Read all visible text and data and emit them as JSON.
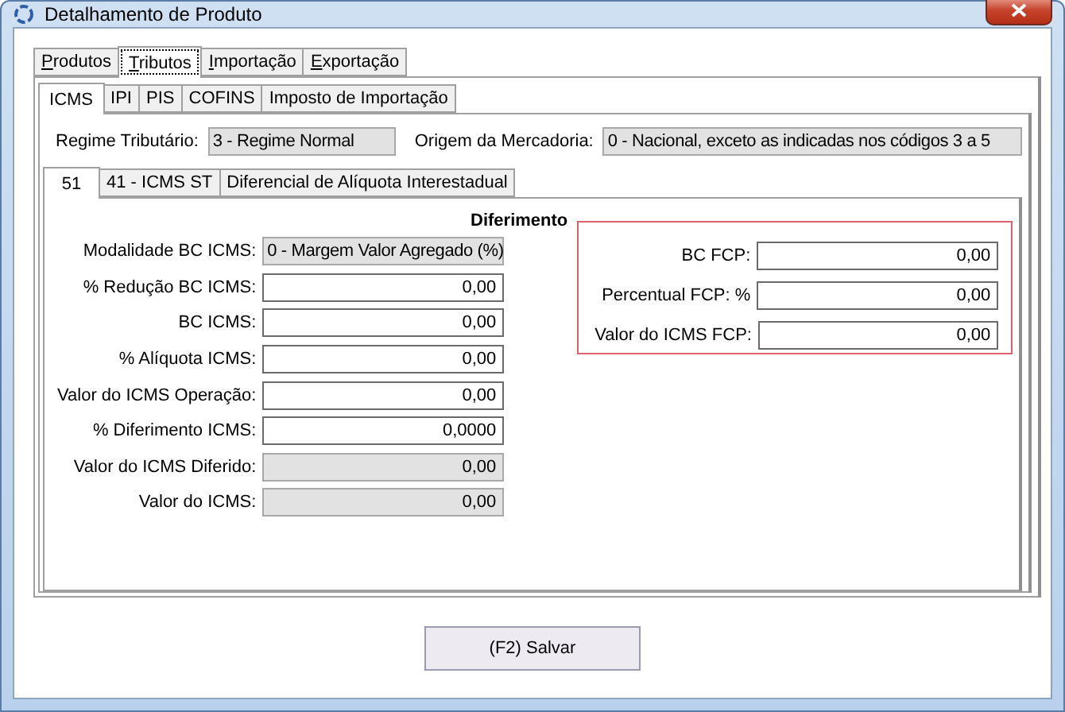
{
  "window": {
    "title": "Detalhamento de Produto"
  },
  "main_tabs": [
    {
      "label": "Produtos",
      "selected": false
    },
    {
      "label": "Tributos",
      "selected": true
    },
    {
      "label": "Importação",
      "selected": false
    },
    {
      "label": "Exportação",
      "selected": false
    }
  ],
  "tax_tabs": [
    {
      "label": "ICMS",
      "selected": true
    },
    {
      "label": "IPI",
      "selected": false
    },
    {
      "label": "PIS",
      "selected": false
    },
    {
      "label": "COFINS",
      "selected": false
    },
    {
      "label": "Imposto de Importação",
      "selected": false
    }
  ],
  "regime": {
    "label": "Regime Tributário:",
    "value": "3 - Regime Normal"
  },
  "origem": {
    "label": "Origem da Mercadoria:",
    "value": "0 - Nacional, exceto as indicadas nos códigos 3 a 5"
  },
  "cst_tabs": [
    {
      "label": "51",
      "selected": true
    },
    {
      "label": "41 - ICMS ST",
      "selected": false
    },
    {
      "label": "Diferencial de Alíquota Interestadual",
      "selected": false
    }
  ],
  "section_title": "Diferimento",
  "left_fields": [
    {
      "label": "Modalidade BC ICMS:",
      "value": "0 - Margem Valor Agregado (%)",
      "kind": "select",
      "disabled": true
    },
    {
      "label": "% Redução BC ICMS:",
      "value": "0,00",
      "kind": "number",
      "disabled": false
    },
    {
      "label": "BC ICMS:",
      "value": "0,00",
      "kind": "number",
      "disabled": false
    },
    {
      "label": "% Alíquota ICMS:",
      "value": "0,00",
      "kind": "number",
      "disabled": false
    },
    {
      "label": "Valor do ICMS Operação:",
      "value": "0,00",
      "kind": "number",
      "disabled": false
    },
    {
      "label": "% Diferimento ICMS:",
      "value": "0,0000",
      "kind": "number",
      "disabled": false
    },
    {
      "label": "Valor do ICMS Diferido:",
      "value": "0,00",
      "kind": "number",
      "disabled": true
    },
    {
      "label": "Valor do ICMS:",
      "value": "0,00",
      "kind": "number",
      "disabled": true
    }
  ],
  "fcp_fields": [
    {
      "label": "BC FCP:",
      "value": "0,00",
      "disabled": false
    },
    {
      "label": "Percentual FCP: %",
      "value": "0,00",
      "disabled": false
    },
    {
      "label": "Valor do ICMS FCP:",
      "value": "0,00",
      "disabled": false
    }
  ],
  "save_button": "(F2) Salvar"
}
